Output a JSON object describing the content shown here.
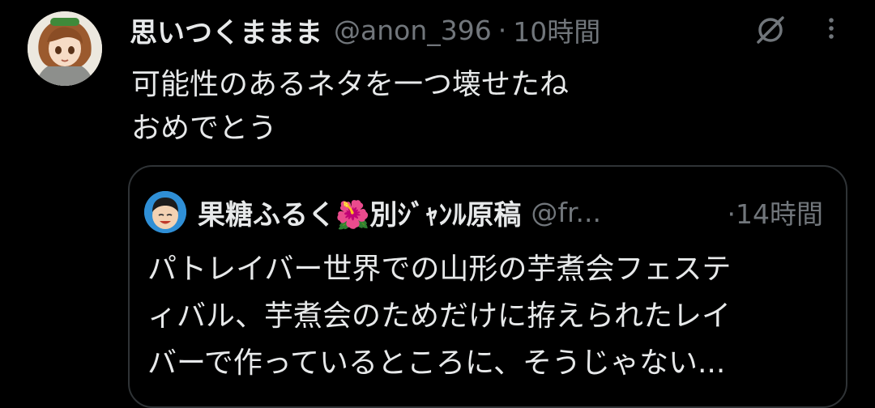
{
  "tweet": {
    "display_name": "思いつくままま",
    "handle": "@anon_396",
    "separator": "·",
    "time": "10時間",
    "text_lines": [
      "可能性のあるネタを一つ壊せたね",
      "おめでとう"
    ],
    "icons": {
      "mute": "mute-icon",
      "more": "more-vertical-icon"
    }
  },
  "quote": {
    "display_name": "果糖ふるく🌺別ｼﾞｬﾝﾙ原稿",
    "handle": "@fr...",
    "time": "·14時間",
    "text_lines": [
      "パトレイバー世界での山形の芋煮会フェステ",
      "ィバル、芋煮会のためだけに拵えられたレイ",
      "バーで作っているところに、そうじゃない..."
    ]
  },
  "colors": {
    "background": "#000000",
    "text_primary": "#e7e9ea",
    "text_secondary": "#71767b",
    "border": "#2f3336"
  }
}
